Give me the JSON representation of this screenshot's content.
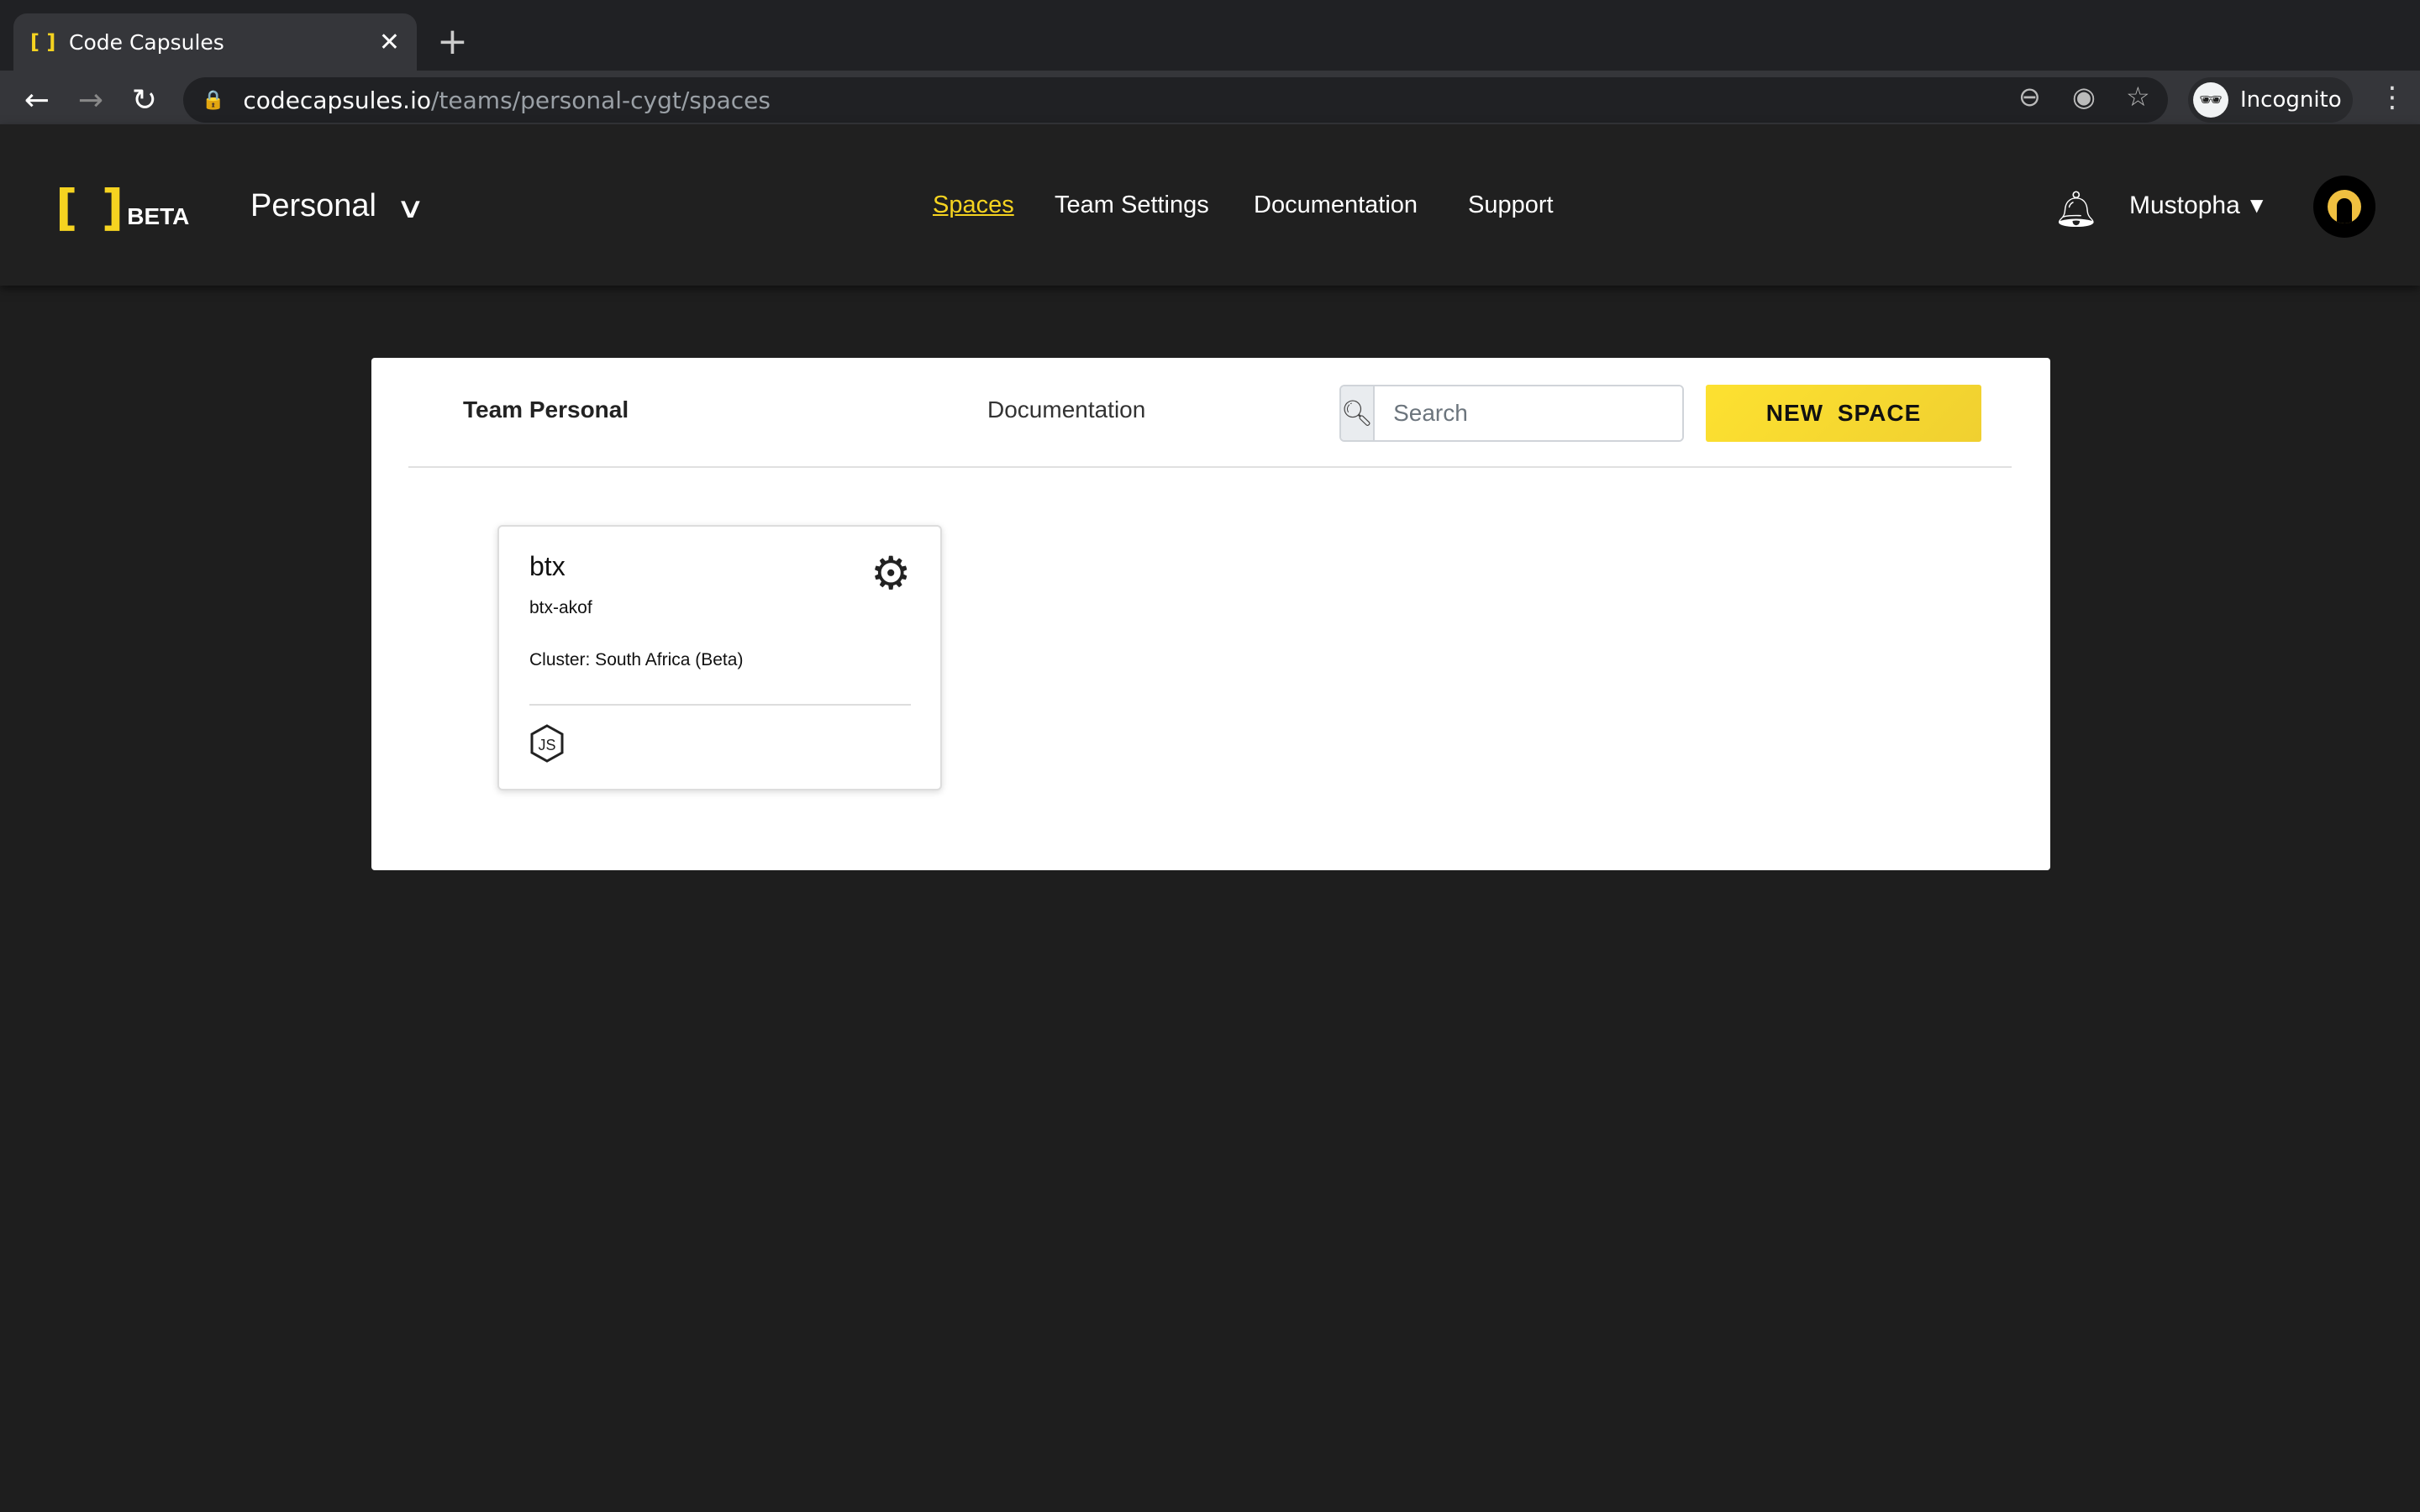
{
  "browser": {
    "tab_title": "Code Capsules",
    "url_host": "codecapsules.io",
    "url_path": "/teams/personal-cygt/spaces",
    "profile_label": "Incognito"
  },
  "header": {
    "logo_text": "BETA",
    "team_name": "Personal",
    "nav": [
      "Spaces",
      "Team Settings",
      "Documentation",
      "Support"
    ],
    "active_nav": "Spaces",
    "user_name": "Mustopha"
  },
  "panel": {
    "title": "Team Personal",
    "documentation_link": "Documentation",
    "search_placeholder": "Search",
    "new_space_label": "NEW SPACE"
  },
  "spaces": [
    {
      "name": "btx",
      "slug": "btx-akof",
      "cluster": "Cluster: South Africa (Beta)",
      "runtime_icon": "nodejs-icon"
    }
  ],
  "colors": {
    "accent": "#f5d320",
    "background": "#1e1e1e"
  }
}
